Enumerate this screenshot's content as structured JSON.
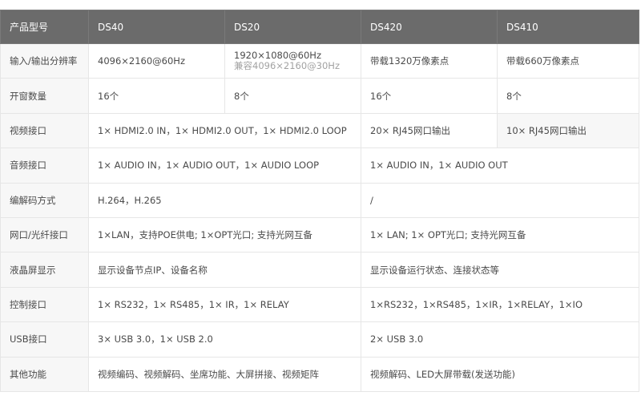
{
  "table": {
    "header": [
      "产品型号",
      "DS40",
      "DS20",
      "DS420",
      "DS410"
    ],
    "rows": [
      {
        "label": "输入/输出分辨率",
        "ds40": "4096×2160@60Hz",
        "ds20_main": "1920×1080@60Hz",
        "ds20_sub": "兼容4096×2160@30Hz",
        "ds420": "带载1320万像素点",
        "ds410": "带载660万像素点"
      },
      {
        "label": "开窗数量",
        "ds40": "16个",
        "ds20": "8个",
        "ds420": "16个",
        "ds410": "8个"
      },
      {
        "label": "视频接口",
        "ds40_ds20": "1× HDMI2.0 IN，1× HDMI2.0 OUT，1× HDMI2.0 LOOP",
        "ds420": "20× RJ45网口输出",
        "ds410": "10× RJ45网口输出"
      },
      {
        "label": "音频接口",
        "ds40_ds20": "1× AUDIO IN，1× AUDIO OUT，1× AUDIO LOOP",
        "ds420_ds410": "1× AUDIO IN，1× AUDIO OUT"
      },
      {
        "label": "编解码方式",
        "ds40_ds20": "H.264，H.265",
        "ds420_ds410": "/"
      },
      {
        "label": "网口/光纤接口",
        "ds40_ds20": "1×LAN，支持POE供电; 1×OPT光口; 支持光网互备",
        "ds420_ds410": "1× LAN; 1× OPT光口; 支持光网互备"
      },
      {
        "label": "液晶屏显示",
        "ds40_ds20": "显示设备节点IP、设备名称",
        "ds420_ds410": "显示设备运行状态、连接状态等"
      },
      {
        "label": "控制接口",
        "ds40_ds20": "1× RS232，1× RS485，1× IR，1× RELAY",
        "ds420_ds410": "1×RS232，1×RS485，1×IR，1×RELAY，1×IO"
      },
      {
        "label": "USB接口",
        "ds40_ds20": "3× USB 3.0，1× USB 2.0",
        "ds420_ds410": "2× USB 3.0"
      },
      {
        "label": "其他功能",
        "ds40_ds20": "视频编码、视频解码、坐席功能、大屏拼接、视频矩阵",
        "ds420_ds410": "视频解码、LED大屏带载(发送功能)"
      }
    ]
  }
}
